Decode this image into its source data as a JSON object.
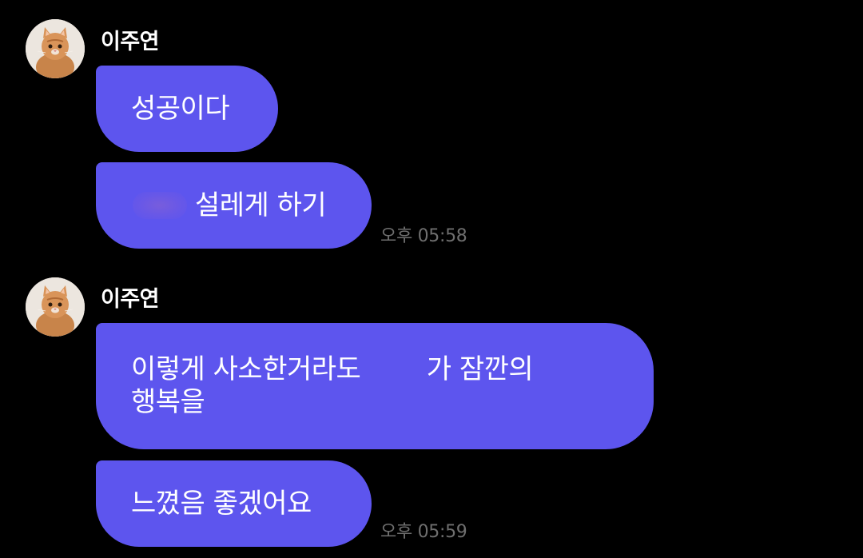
{
  "colors": {
    "background": "#000000",
    "bubble": "#5d55ee",
    "bubble_text": "#ffffff",
    "name_text": "#ffffff",
    "timestamp_text": "#6f6f6f"
  },
  "groups": [
    {
      "sender": "이주연",
      "avatar_icon": "cat-avatar-icon",
      "messages": [
        {
          "text": "성공이다"
        },
        {
          "text": "설레게 하기",
          "leading_blur": true
        }
      ],
      "time": "오후 05:58"
    },
    {
      "sender": "이주연",
      "avatar_icon": "cat-avatar-icon",
      "messages": [
        {
          "line1": "이렇게 사소한거라도        가 잠깐의",
          "line2": "행복을"
        },
        {
          "text": "느꼈음 좋겠어요"
        }
      ],
      "time": "오후 05:59"
    }
  ]
}
